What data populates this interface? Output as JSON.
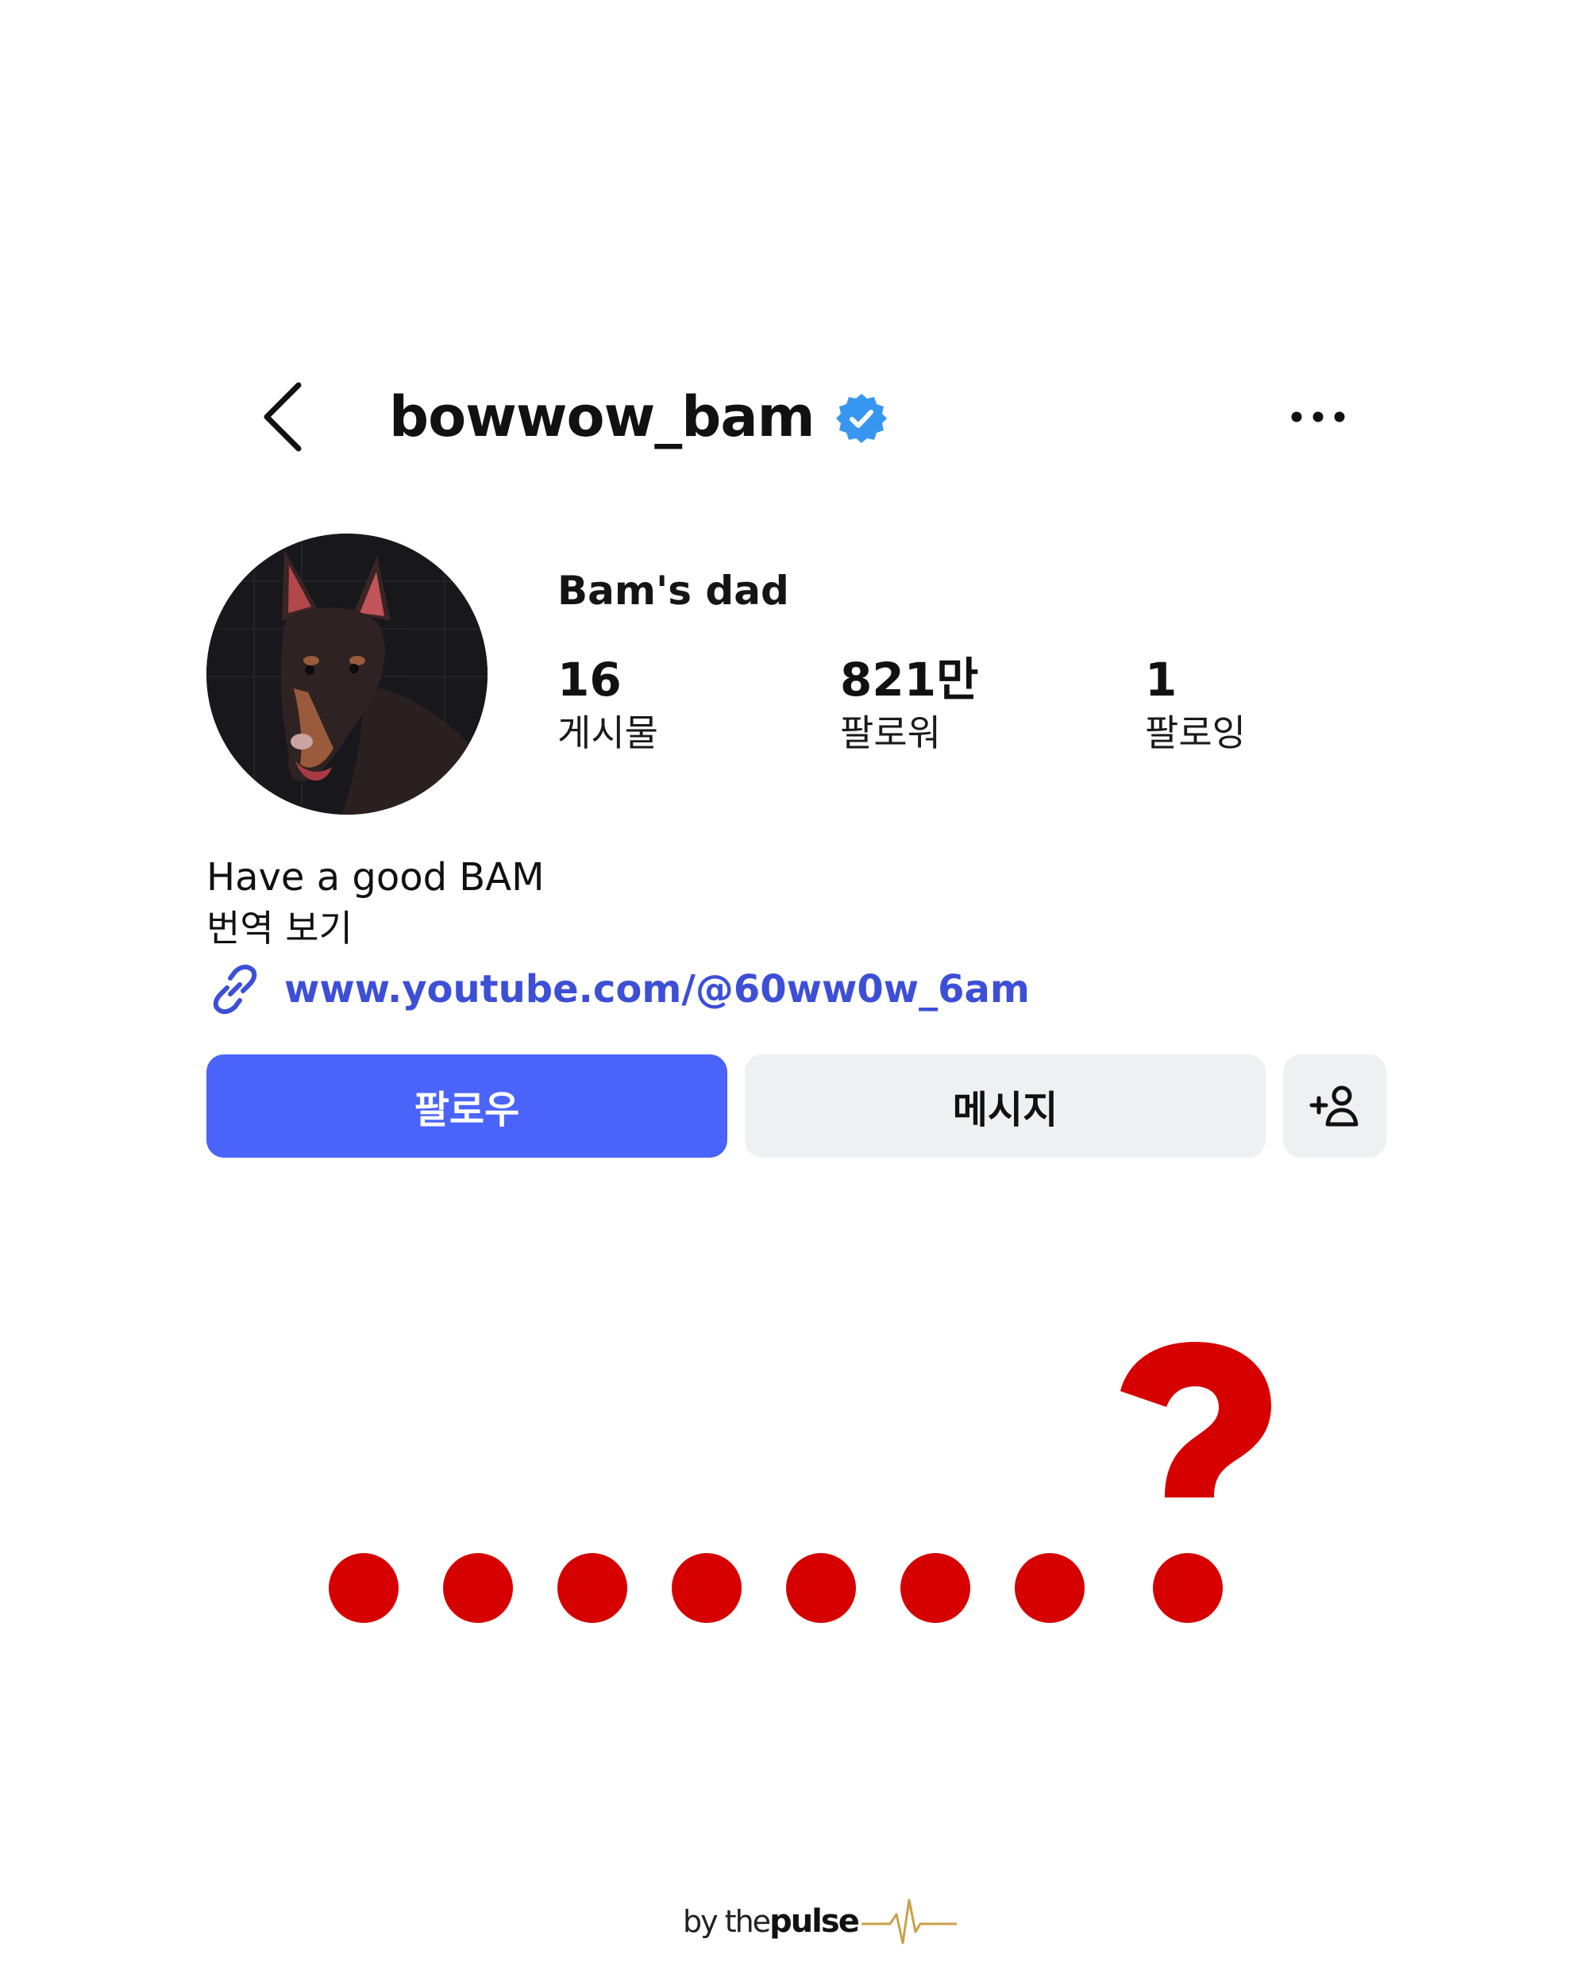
{
  "header": {
    "username": "bowwow_bam",
    "verified": true,
    "back_icon": "chevron-left-icon",
    "more_icon": "more-horizontal-icon"
  },
  "profile": {
    "display_name": "Bam's dad",
    "stats": [
      {
        "value": "16",
        "label": "게시물"
      },
      {
        "value": "821만",
        "label": "팔로워"
      },
      {
        "value": "1",
        "label": "팔로잉"
      }
    ],
    "bio": "Have a good BAM",
    "translate_label": "번역 보기",
    "link": "www.youtube.com/@60ww0w_6am"
  },
  "actions": {
    "follow_label": "팔로우",
    "message_label": "메시지",
    "add_user_icon": "person-add-icon"
  },
  "overlay": {
    "dot_count": 8,
    "mark_icon": "question-mark-icon",
    "color": "#d60000"
  },
  "footer": {
    "brand_prefix": "by the",
    "brand_name": "pulse"
  },
  "colors": {
    "accent": "#4a63fa",
    "link": "#3d4fd6",
    "verified": "#3797f0",
    "button_gray": "#eff0f2",
    "overlay_red": "#d60000"
  }
}
